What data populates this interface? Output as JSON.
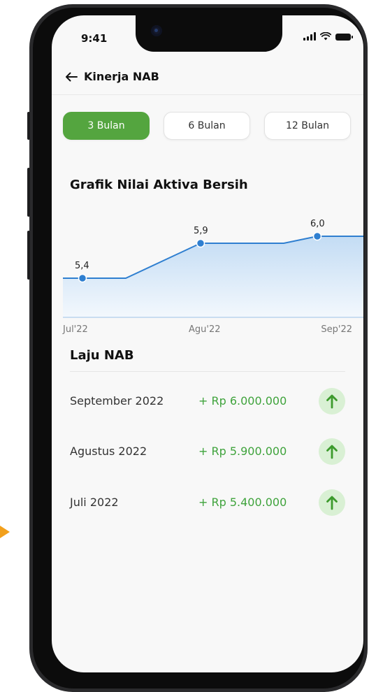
{
  "status_bar": {
    "time": "9:41"
  },
  "header": {
    "title": "Kinerja NAB",
    "back_icon": "arrow-left-icon"
  },
  "tabs": [
    {
      "label": "3 Bulan",
      "active": true
    },
    {
      "label": "6 Bulan",
      "active": false
    },
    {
      "label": "12 Bulan",
      "active": false
    }
  ],
  "chart": {
    "title": "Grafik Nilai Aktiva Bersih"
  },
  "chart_data": {
    "type": "area",
    "title": "Grafik Nilai Aktiva Bersih",
    "x_labels": [
      "Jul'22",
      "Agu'22",
      "Sep'22"
    ],
    "points": [
      {
        "x": "Jul'22",
        "y": 5.4,
        "label": "5,4"
      },
      {
        "x": "Agu'22",
        "y": 5.9,
        "label": "5,9"
      },
      {
        "x": "Sep'22",
        "y": 6.0,
        "label": "6,0"
      }
    ],
    "ylim": [
      5.0,
      6.2
    ],
    "grid": false,
    "colors": {
      "line": "#2f7fd0",
      "point": "#2f7fd0",
      "fill_top": "#c3dcf4",
      "fill_bottom": "#f3f8fd"
    }
  },
  "laju": {
    "title": "Laju NAB",
    "rows": [
      {
        "month": "September 2022",
        "amount": "+ Rp 6.000.000",
        "icon": "arrow-up-icon"
      },
      {
        "month": "Agustus 2022",
        "amount": "+ Rp 5.900.000",
        "icon": "arrow-up-icon"
      },
      {
        "month": "Juli 2022",
        "amount": "+ Rp 5.400.000",
        "icon": "arrow-up-icon"
      }
    ]
  },
  "colors": {
    "accent_green": "#54a53f",
    "amount_green": "#3fa33c",
    "badge_bg": "#d9f0d4",
    "chart_blue": "#2f7fd0"
  }
}
